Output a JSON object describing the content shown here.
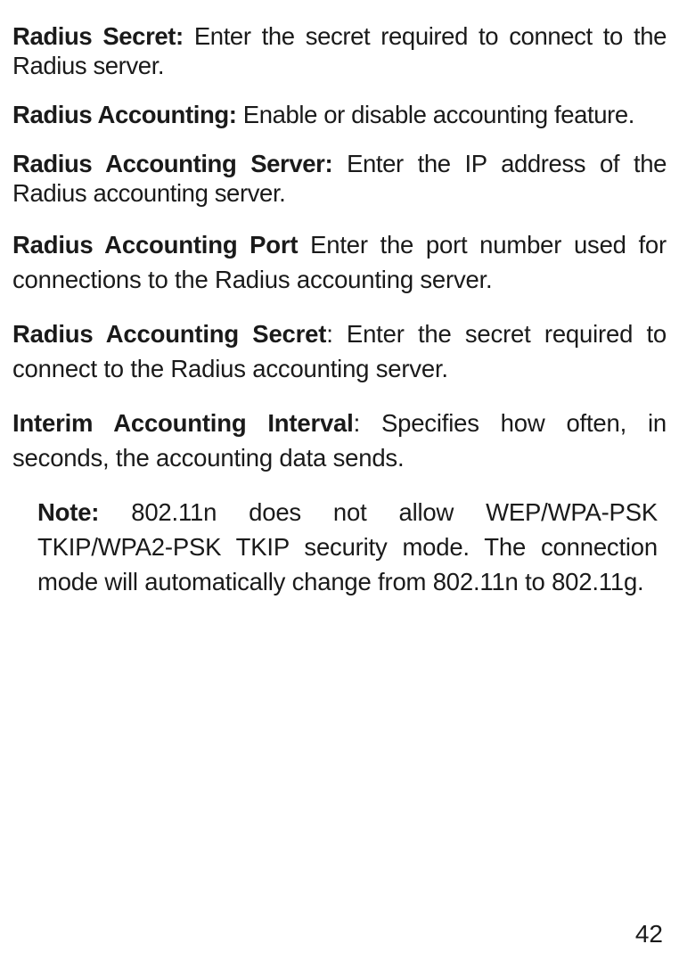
{
  "definitions": [
    {
      "label": "Radius Secret:",
      "text": "Enter the secret required to connect to the Radius server."
    },
    {
      "label": "Radius Accounting:",
      "text": "Enable or disable accounting feature."
    },
    {
      "label": "Radius Accounting Server:",
      "text": "Enter the IP address of the Radius accounting server."
    },
    {
      "label": "Radius Accounting Port",
      "text": "Enter the port number used for connections to the Radius accounting server."
    },
    {
      "label": "Radius Accounting Secret",
      "text": ": Enter the secret required to connect to the Radius accounting server."
    },
    {
      "label": "Interim Accounting Interval",
      "text": ": Specifies how often, in seconds, the accounting data sends."
    }
  ],
  "note": {
    "label": "Note:",
    "text": "802.11n does not allow WEP/WPA-PSK TKIP/WPA2-PSK TKIP security mode. The connection mode will automatically change from 802.11n to 802.11g."
  },
  "page_number": "42"
}
